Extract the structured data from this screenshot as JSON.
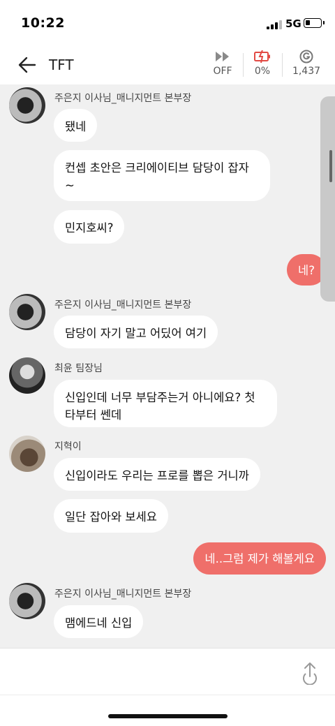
{
  "status_bar": {
    "time": "10:22",
    "network": "5G"
  },
  "header": {
    "title": "TFT",
    "stats": [
      {
        "icon": "fast-forward-icon",
        "value": "OFF"
      },
      {
        "icon": "battery-alert-icon",
        "value": "0%"
      },
      {
        "icon": "g-coin-icon",
        "value": "1,437"
      }
    ]
  },
  "messages": [
    {
      "type": "other",
      "sender": "주은지 이사님_매니지먼트 본부장",
      "texts": [
        "됐네",
        "컨셉 초안은 크리에이티브 담당이 잡자\n~",
        "민지호씨?"
      ]
    },
    {
      "type": "mine",
      "text": "네?"
    },
    {
      "type": "other",
      "sender": "주은지 이사님_매니지먼트 본부장",
      "texts": [
        "담당이 자기 말고 어딨어 여기"
      ]
    },
    {
      "type": "other",
      "sender": "최윤 팀장님",
      "texts": [
        "신입인데 너무 부담주는거 아니에요? 첫\n타부터 쎈데"
      ]
    },
    {
      "type": "other",
      "sender": "지혁이",
      "texts": [
        "신입이라도 우리는 프로를 뽑은 거니까",
        "일단 잡아와 보세요"
      ]
    },
    {
      "type": "mine",
      "text": "네..그럼 제가 해볼게요"
    },
    {
      "type": "other",
      "sender": "주은지 이사님_매니지먼트 본부장",
      "texts": [
        "맴에드네 신입"
      ]
    }
  ],
  "colors": {
    "my_bubble": "#ef6f6a",
    "chat_bg": "#f0f0f0",
    "battery_alert": "#e24a44"
  }
}
